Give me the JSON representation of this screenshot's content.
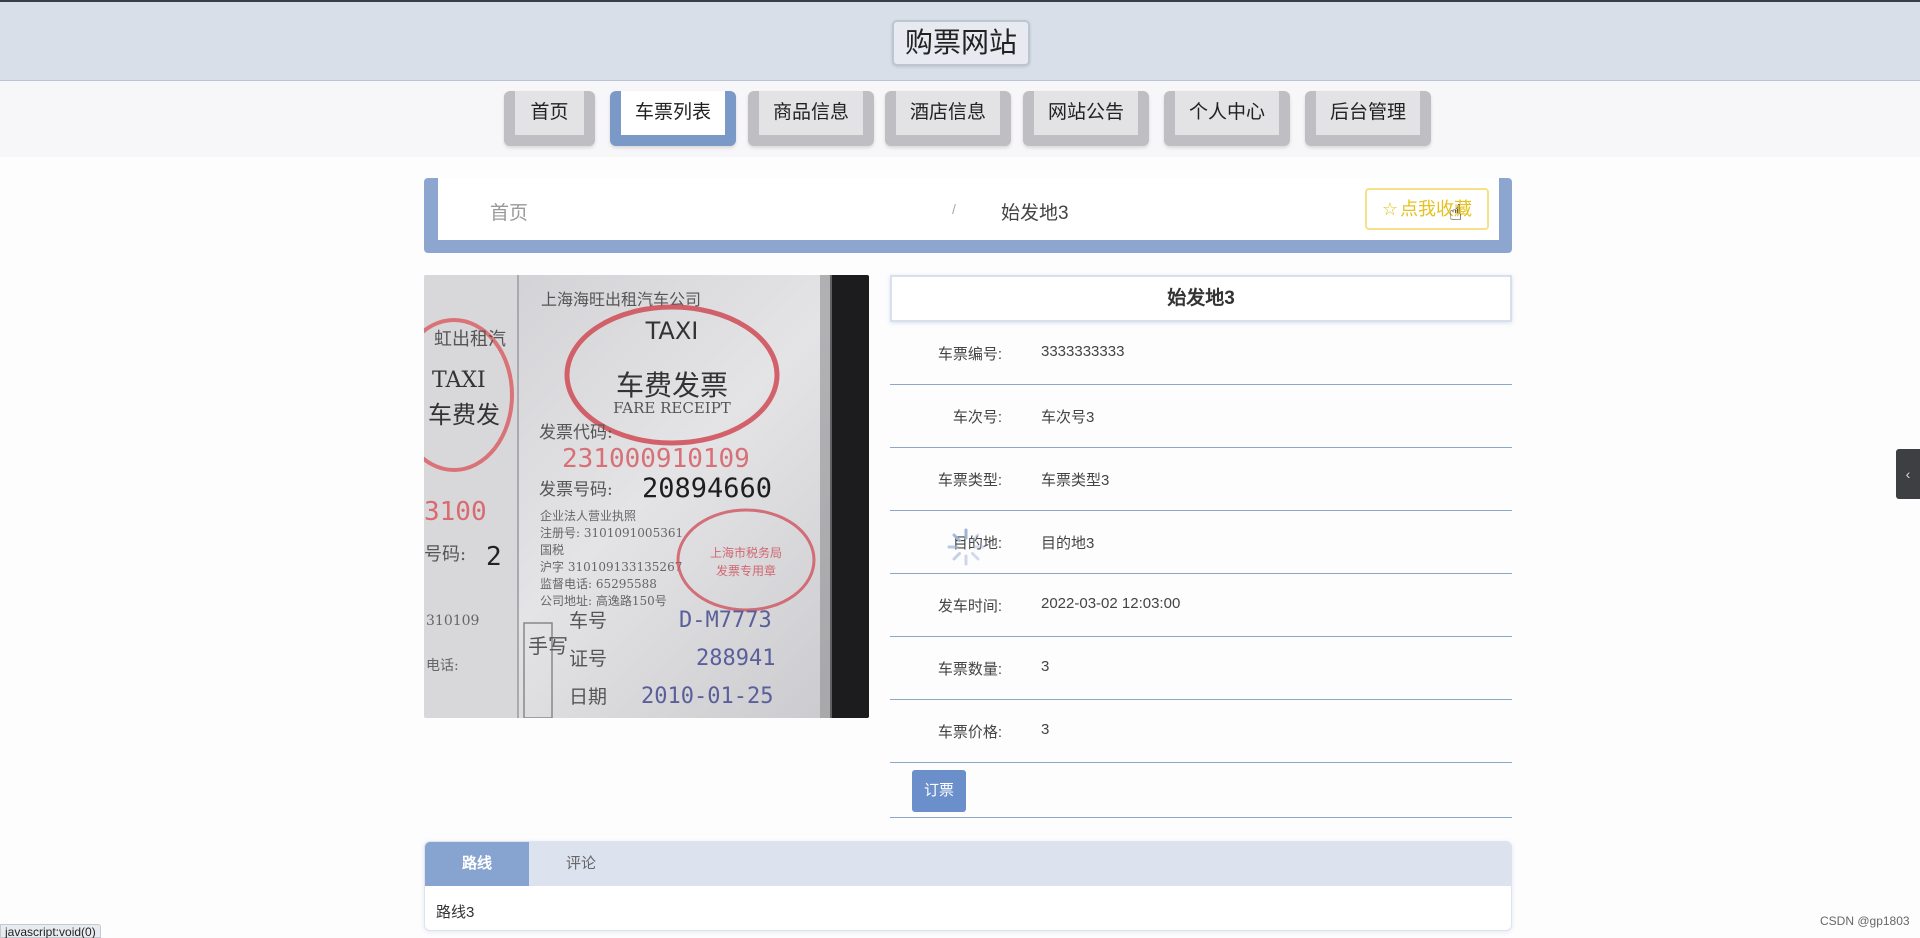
{
  "header": {
    "site_title": "购票网站"
  },
  "nav": {
    "items": [
      {
        "label": "首页"
      },
      {
        "label": "车票列表",
        "active": true
      },
      {
        "label": "商品信息"
      },
      {
        "label": "酒店信息"
      },
      {
        "label": "网站公告"
      },
      {
        "label": "个人中心"
      },
      {
        "label": "后台管理"
      }
    ]
  },
  "breadcrumb": {
    "home": "首页",
    "separator": "/",
    "current": "始发地3"
  },
  "favorite_button": {
    "label": "点我收藏",
    "icon": "star-outline-icon"
  },
  "ticket_image": {
    "company": "上海海旺出租汽车公司",
    "taxi": "TAXI",
    "title_cn": "车费发票",
    "title_en": "FARE RECEIPT",
    "code_label": "发票代码:",
    "code": "231000910109",
    "number_label": "发票号码:",
    "number": "20894660",
    "plate_label": "车号",
    "plate": "D-M7773",
    "cert_label": "证号",
    "cert": "288941",
    "date_label": "日期",
    "date": "2010-01-25",
    "handwritten": "手写"
  },
  "detail": {
    "title": "始发地3",
    "rows": [
      {
        "label": "车票编号:",
        "value": "3333333333"
      },
      {
        "label": "车次号:",
        "value": "车次号3"
      },
      {
        "label": "车票类型:",
        "value": "车票类型3"
      },
      {
        "label": "目的地:",
        "value": "目的地3"
      },
      {
        "label": "发车时间:",
        "value": "2022-03-02 12:03:00"
      },
      {
        "label": "车票数量:",
        "value": "3"
      },
      {
        "label": "车票价格:",
        "value": "3"
      }
    ],
    "order_button": "订票"
  },
  "tabs": {
    "items": [
      {
        "label": "路线",
        "active": true
      },
      {
        "label": "评论"
      }
    ],
    "content": "路线3"
  },
  "side_toggle": {
    "icon": "chevron-left-icon"
  },
  "status_bar": {
    "link": "javascript:void(0)"
  },
  "watermark": "CSDN @gp1803",
  "colors": {
    "accent": "#7b99c7",
    "header_bg": "#d9dfe8",
    "favorite": "#e5c21f",
    "order_button": "#6b8fca"
  }
}
